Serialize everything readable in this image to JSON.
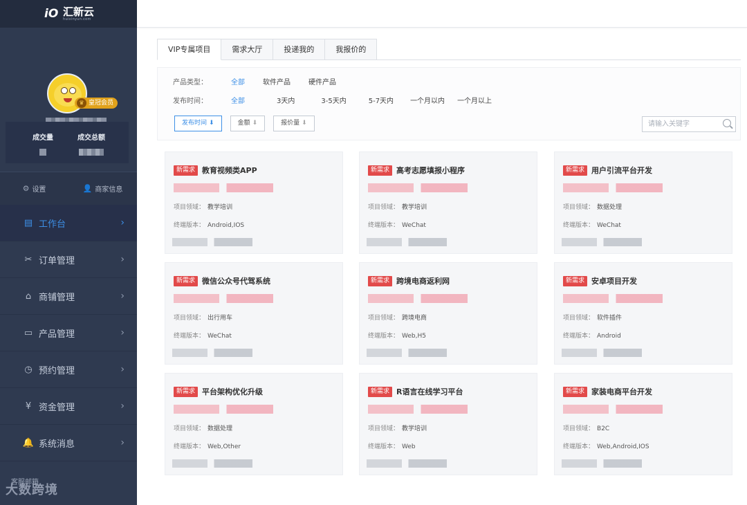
{
  "brand": {
    "name": "汇新云",
    "domain": "huixinyun.com"
  },
  "profile": {
    "badge": "皇冠会员"
  },
  "stats": [
    {
      "label": "成交量"
    },
    {
      "label": "成交总额"
    }
  ],
  "quick_links": [
    {
      "label": "设置",
      "icon": "gear-icon"
    },
    {
      "label": "商家信息",
      "icon": "user-icon"
    }
  ],
  "nav": [
    {
      "label": "工作台",
      "icon": "briefcase-icon",
      "active": true
    },
    {
      "label": "订单管理",
      "icon": "tools-icon"
    },
    {
      "label": "商铺管理",
      "icon": "store-icon"
    },
    {
      "label": "产品管理",
      "icon": "folder-icon"
    },
    {
      "label": "预约管理",
      "icon": "clock-icon"
    },
    {
      "label": "资金管理",
      "icon": "yen-icon"
    },
    {
      "label": "系统消息",
      "icon": "bell-icon"
    }
  ],
  "sidebar_footer": "客服邮箱",
  "tabs": [
    {
      "label": "VIP专属项目",
      "active": true
    },
    {
      "label": "需求大厅"
    },
    {
      "label": "投递我的"
    },
    {
      "label": "我报价的"
    }
  ],
  "filters": {
    "type_label": "产品类型：",
    "type_options": [
      "全部",
      "软件产品",
      "硬件产品"
    ],
    "time_label": "发布时间：",
    "time_options": [
      "全部",
      "3天内",
      "3-5天内",
      "5-7天内",
      "一个月以内",
      "一个月以上"
    ]
  },
  "sort": [
    {
      "label": "发布时间",
      "arrow": "⬇",
      "active": true
    },
    {
      "label": "金额",
      "arrow": "⬇"
    },
    {
      "label": "报价量",
      "arrow": "⬇"
    }
  ],
  "search": {
    "placeholder": "请输入关键字"
  },
  "card_labels": {
    "tag": "新需求",
    "domain": "项目领域：",
    "platform": "终端版本："
  },
  "cards": [
    {
      "title": "教育视频类APP",
      "domain": "教学培训",
      "platform": "Android,IOS"
    },
    {
      "title": "高考志愿填报小程序",
      "domain": "教学培训",
      "platform": "WeChat"
    },
    {
      "title": "用户引流平台开发",
      "domain": "数据处理",
      "platform": "WeChat"
    },
    {
      "title": "微信公众号代驾系统",
      "domain": "出行用车",
      "platform": "WeChat"
    },
    {
      "title": "跨境电商返利网",
      "domain": "跨境电商",
      "platform": "Web,H5"
    },
    {
      "title": "安卓项目开发",
      "domain": "软件插件",
      "platform": "Android"
    },
    {
      "title": "平台架构优化升级",
      "domain": "数据处理",
      "platform": "Web,Other"
    },
    {
      "title": "R语言在线学习平台",
      "domain": "教学培训",
      "platform": "Web"
    },
    {
      "title": "家装电商平台开发",
      "domain": "B2C",
      "platform": "Web,Android,IOS"
    }
  ],
  "watermark": "大数跨境",
  "colors": {
    "sidebar": "#2f3a50",
    "accent": "#3d8fe6",
    "tag": "#e24a4a",
    "vip": "#e0a11b"
  }
}
